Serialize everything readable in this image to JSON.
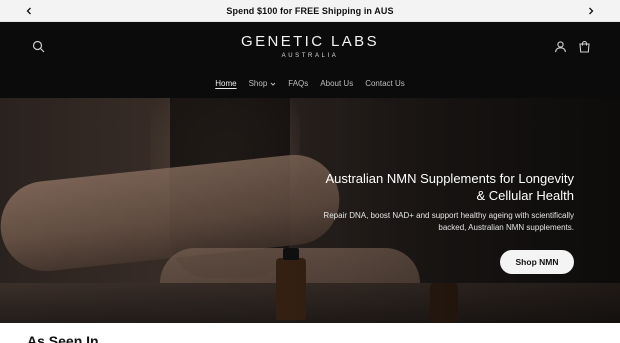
{
  "announcement": {
    "text": "Spend $100 for FREE Shipping in AUS",
    "prev_icon": "chevron-left-icon",
    "next_icon": "chevron-right-icon"
  },
  "header": {
    "logo_main": "GENETIC LABS",
    "logo_sub": "AUSTRALIA",
    "icons": {
      "search": "search-icon",
      "account": "user-icon",
      "cart": "cart-icon"
    },
    "nav": [
      {
        "label": "Home",
        "active": true
      },
      {
        "label": "Shop",
        "has_dropdown": true
      },
      {
        "label": "FAQs"
      },
      {
        "label": "About Us"
      },
      {
        "label": "Contact Us"
      }
    ]
  },
  "hero": {
    "title": "Australian NMN Supplements for Longevity & Cellular Health",
    "subtitle": "Repair DNA, boost NAD+ and support healthy ageing with scientifically backed, Australian NMN supplements.",
    "cta_label": "Shop NMN"
  },
  "section": {
    "heading": "As Seen In"
  },
  "colors": {
    "announcement_bg": "#f3f3f3",
    "header_bg": "#0b0b0b",
    "button_bg": "#f4f4f4"
  }
}
